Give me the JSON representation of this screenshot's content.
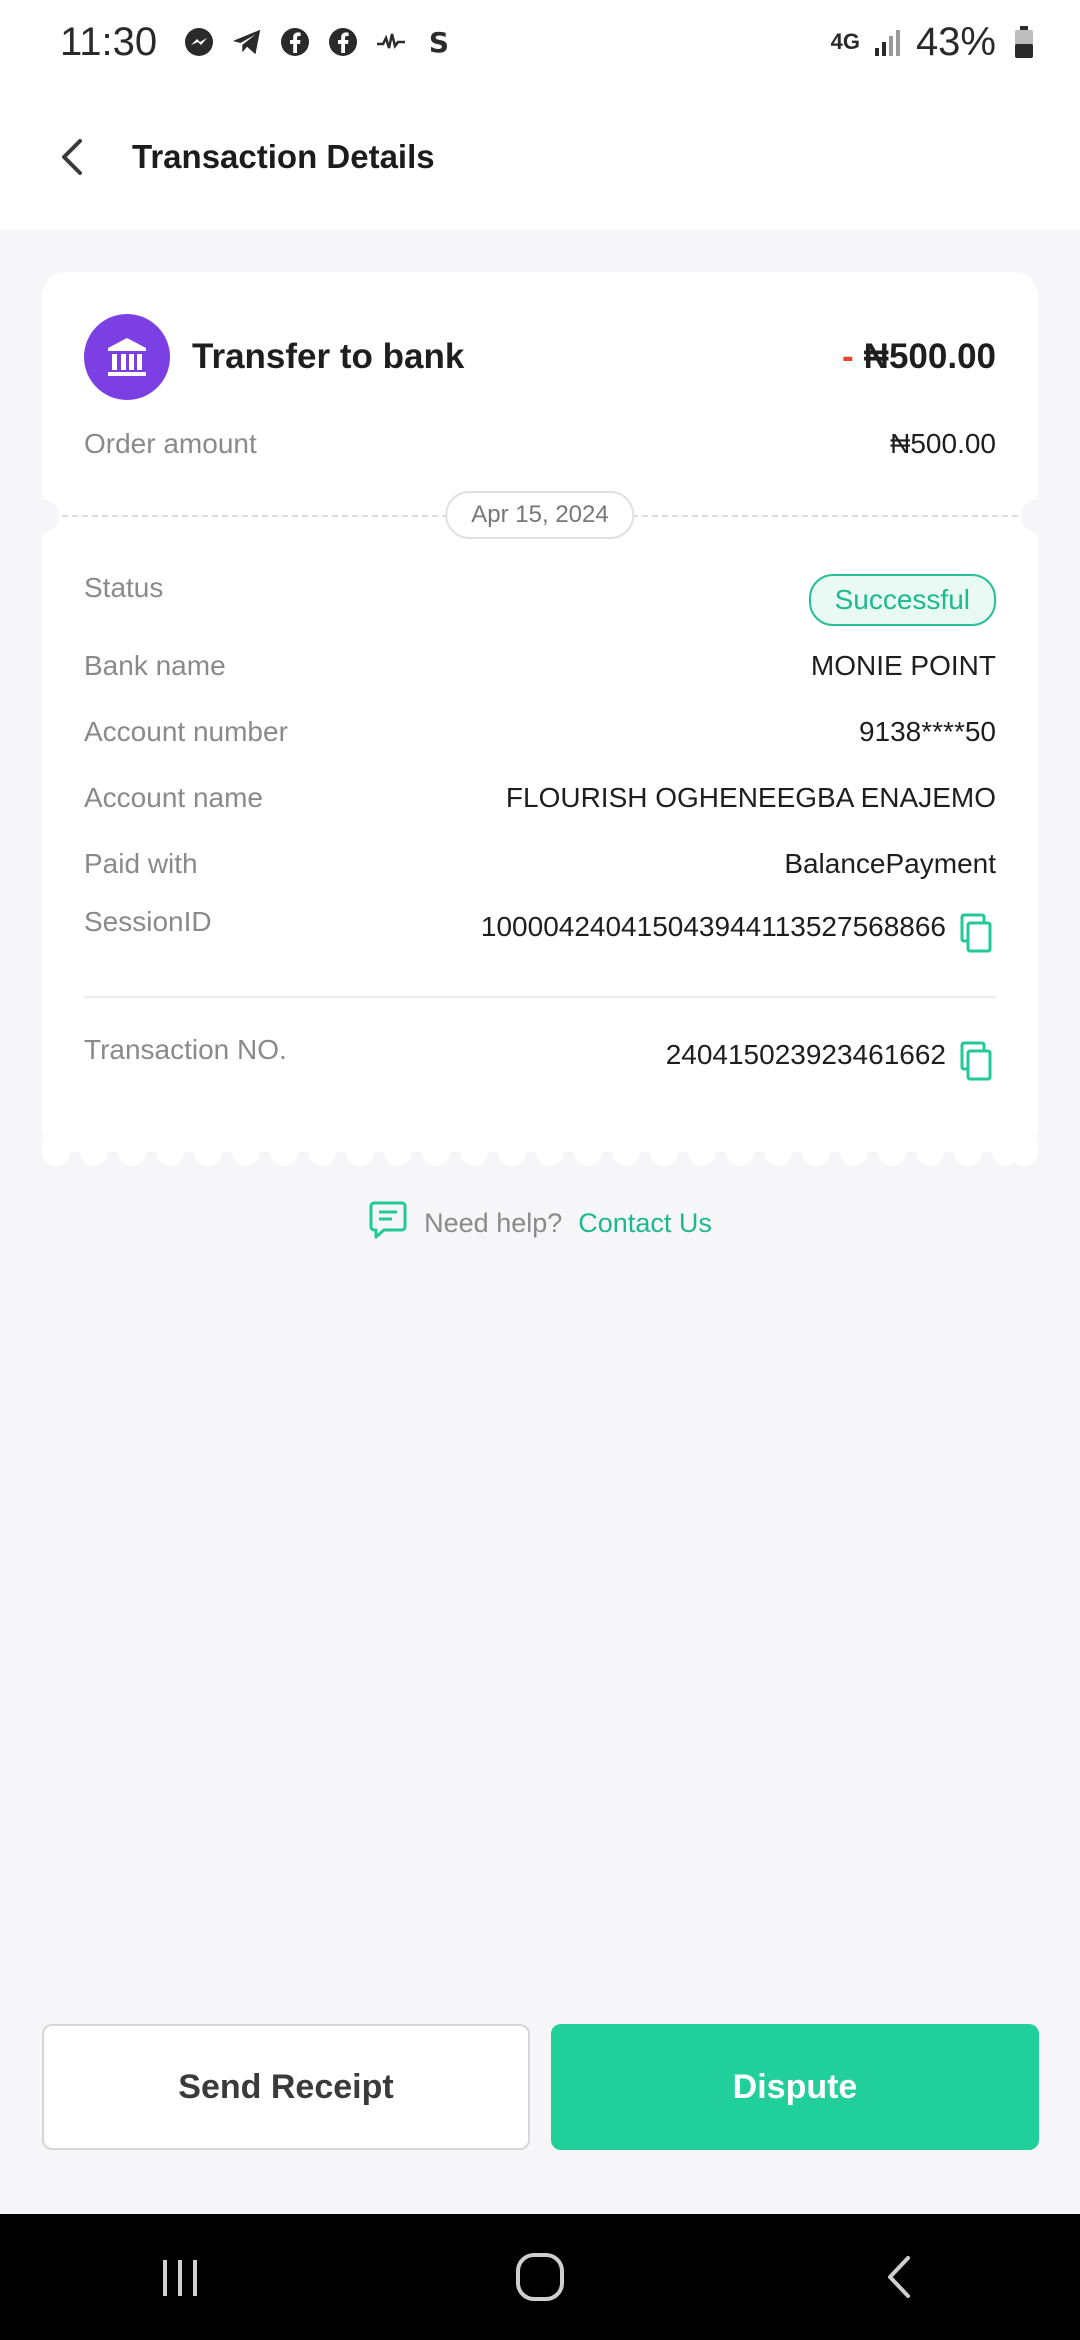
{
  "status_bar": {
    "time": "11:30",
    "network": "4G",
    "battery": "43%"
  },
  "header": {
    "title": "Transaction Details"
  },
  "transaction": {
    "title": "Transfer to bank",
    "amount_sign": "-",
    "amount": "₦500.00",
    "order_amount_label": "Order amount",
    "order_amount": "₦500.00",
    "date": "Apr 15, 2024"
  },
  "details": {
    "status_label": "Status",
    "status_value": "Successful",
    "bank_name_label": "Bank name",
    "bank_name": "MONIE POINT",
    "account_number_label": "Account number",
    "account_number": "9138****50",
    "account_name_label": "Account name",
    "account_name": "FLOURISH OGHENEEGBA ENAJEMO",
    "paid_with_label": "Paid with",
    "paid_with": "BalancePayment",
    "session_id_label": "SessionID",
    "session_id": "100004240415043944113527568866",
    "transaction_no_label": "Transaction NO.",
    "transaction_no": "240415023923461662"
  },
  "help": {
    "text": "Need help?",
    "link": "Contact Us"
  },
  "actions": {
    "send_receipt": "Send Receipt",
    "dispute": "Dispute"
  },
  "colors": {
    "accent": "#20cf99",
    "bank_icon_bg": "#7b3fe4",
    "negative": "#e8452c"
  },
  "icons": {
    "back": "chevron-left-icon",
    "bank": "bank-icon",
    "copy": "copy-icon",
    "chat": "chat-icon"
  }
}
